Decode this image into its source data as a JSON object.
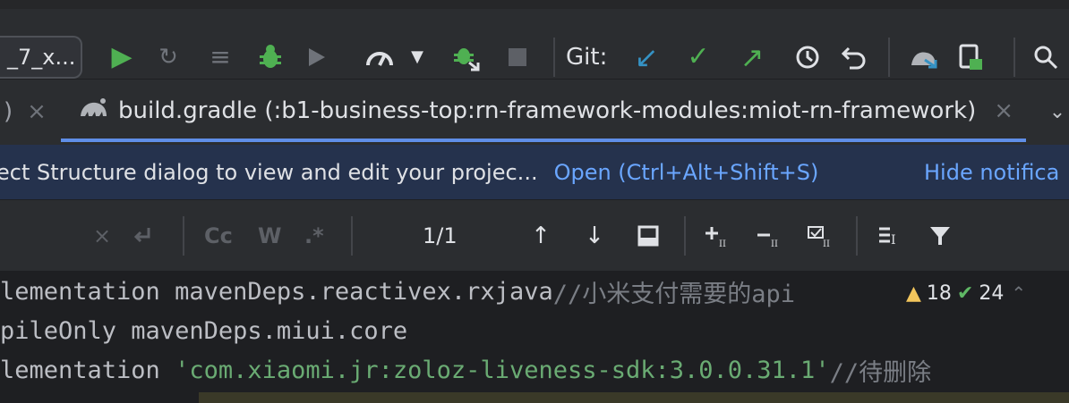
{
  "toolbar": {
    "run_config": "_7_x...",
    "git_label": "Git:",
    "colors": {
      "green": "#4fb052",
      "blue": "#3592c4",
      "gray": "#6f737a",
      "bg": "#2b2d30"
    },
    "icons": [
      "run-icon",
      "rerun-icon",
      "build-icon",
      "debug-icon",
      "coverage-icon",
      "profile-icon",
      "dropdown-icon",
      "attach-debugger-icon",
      "stop-icon",
      "git-update-icon",
      "git-commit-icon",
      "git-push-icon",
      "git-history-icon",
      "git-rollback-icon",
      "sync-gradle-icon",
      "device-manager-icon",
      "search-icon"
    ]
  },
  "tabs": {
    "prev_fragment": ")",
    "active_label": "build.gradle (:b1-business-top:rn-framework-modules:miot-rn-framework)",
    "close_glyph": "×",
    "more_glyph": "⌄"
  },
  "banner": {
    "message": "ect Structure dialog to view and edit your projec...",
    "open_link": "Open (Ctrl+Alt+Shift+S)",
    "hide_link": "Hide notifica"
  },
  "search": {
    "clear_glyph": "×",
    "regex_label": ".*",
    "case_label": "Cc",
    "word_label": "W",
    "match_count": "1/1"
  },
  "editor": {
    "lines": [
      {
        "prefix": "lementation mavenDeps.reactivex.rxjava",
        "string": "",
        "comment": "//小米支付需要的api"
      },
      {
        "prefix": "pileOnly mavenDeps.miui.core",
        "string": "",
        "comment": ""
      },
      {
        "prefix": "lementation ",
        "string": "'com.xiaomi.jr:zoloz-liveness-sdk:3.0.0.31.1'",
        "comment": "//待删除"
      }
    ],
    "warnings": "18",
    "weak_warnings": "24"
  }
}
